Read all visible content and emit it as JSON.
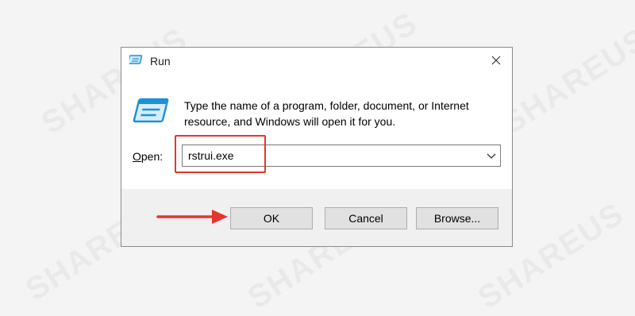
{
  "watermark": {
    "text": "SHAREUS"
  },
  "dialog": {
    "title": "Run",
    "description": "Type the name of a program, folder, document, or Internet resource, and Windows will open it for you.",
    "open_label_accel": "O",
    "open_label_rest": "pen:",
    "input_value": "rstrui.exe",
    "buttons": {
      "ok": "OK",
      "cancel": "Cancel",
      "browse": "Browse..."
    }
  },
  "colors": {
    "annotation": "#e8352a",
    "icon_blue": "#1e90d8"
  },
  "icons": [
    "run-app-icon",
    "close-icon",
    "run-program-icon",
    "chevron-down-icon",
    "annotation-arrow"
  ]
}
